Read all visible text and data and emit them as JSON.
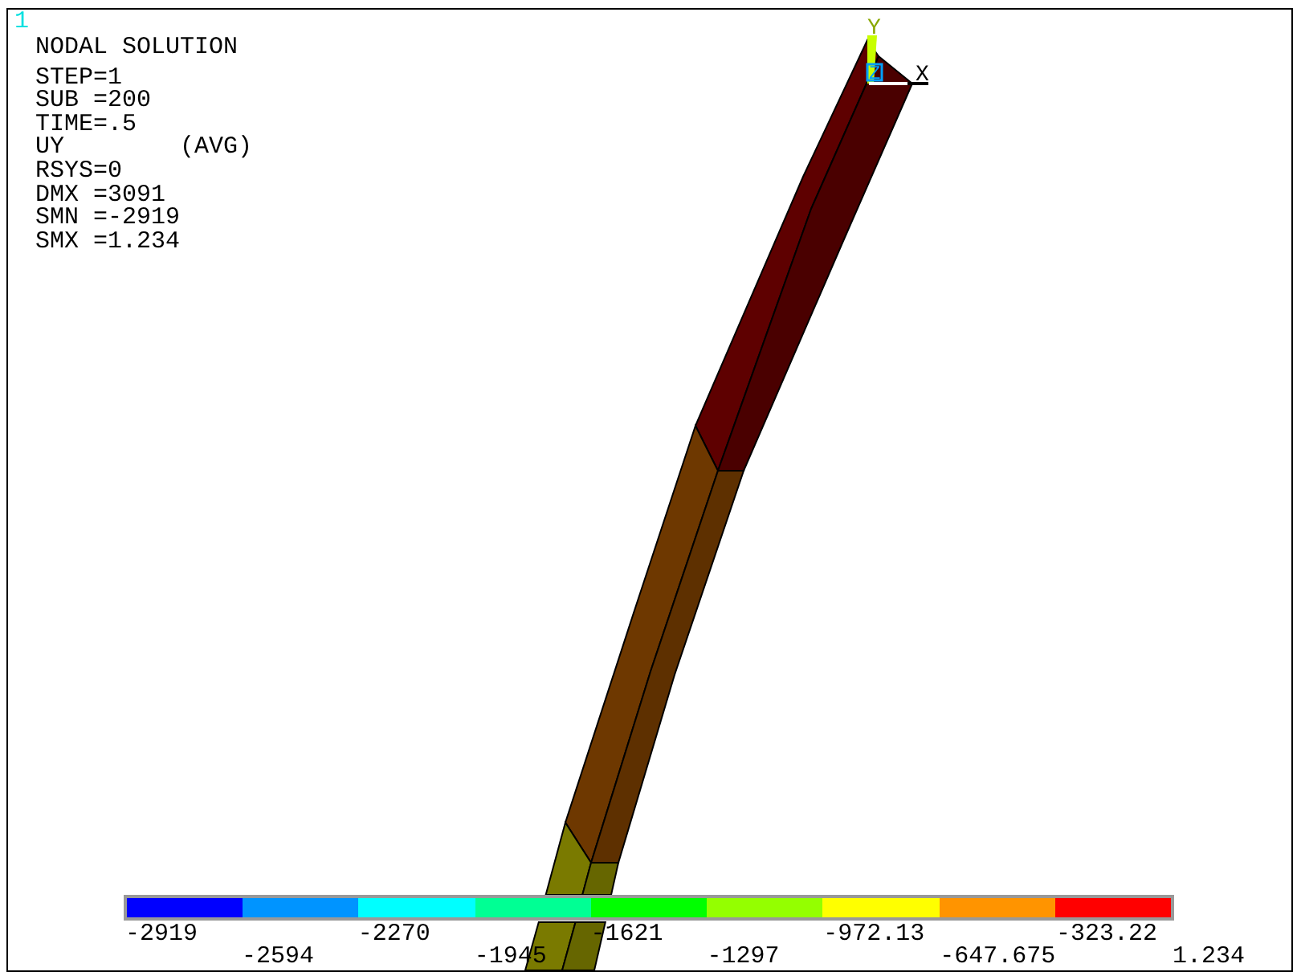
{
  "window_number": "1",
  "header": {
    "title": "NODAL SOLUTION",
    "lines": [
      "STEP=1",
      "SUB =200",
      "TIME=.5",
      "UY        (AVG)",
      "RSYS=0",
      "DMX =3091",
      "SMN =-2919",
      "SMX =1.234"
    ]
  },
  "triad": {
    "y_label": "Y",
    "z_label": "Z",
    "x_label": "X"
  },
  "legend": {
    "bands": [
      {
        "color": "#0000ff"
      },
      {
        "color": "#0094ff"
      },
      {
        "color": "#00ffff"
      },
      {
        "color": "#00ff94"
      },
      {
        "color": "#00ff00"
      },
      {
        "color": "#94ff00"
      },
      {
        "color": "#ffff00"
      },
      {
        "color": "#ff9400"
      },
      {
        "color": "#ff0000"
      }
    ],
    "labels": [
      "-2919",
      "-2594",
      "-2270",
      "-1945",
      "-1621",
      "-1297",
      "-972.13",
      "-647.675",
      "-323.22",
      "1.234"
    ]
  }
}
